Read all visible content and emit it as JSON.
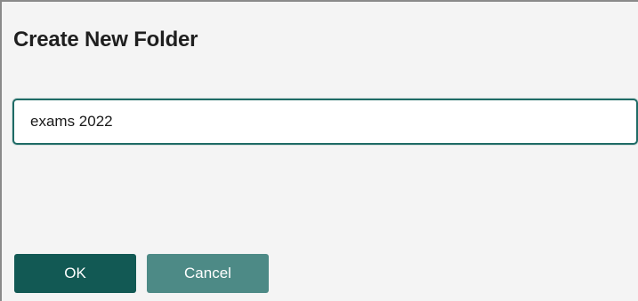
{
  "dialog": {
    "title": "Create New Folder",
    "folder_name_value": "exams 2022",
    "ok_label": "OK",
    "cancel_label": "Cancel"
  },
  "colors": {
    "primary_button": "#125954",
    "secondary_button": "#4d8a86",
    "input_border": "#1f6b66"
  }
}
